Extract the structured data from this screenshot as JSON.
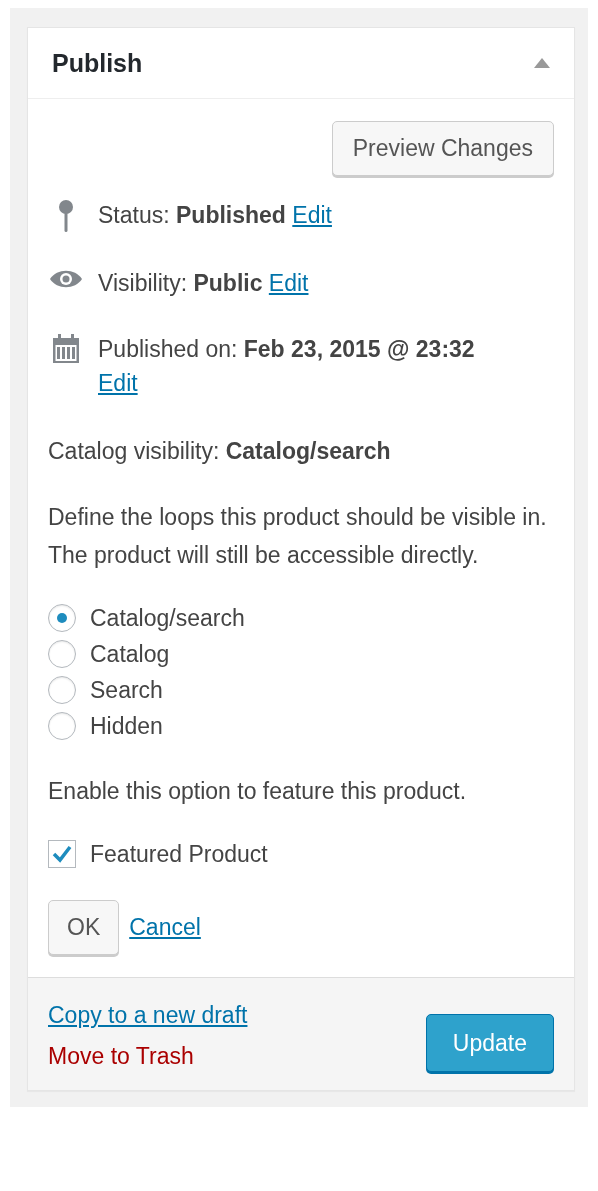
{
  "panel": {
    "title": "Publish",
    "expanded": true
  },
  "preview_button": "Preview Changes",
  "status": {
    "label": "Status:",
    "value": "Published",
    "edit": "Edit"
  },
  "visibility": {
    "label": "Visibility:",
    "value": "Public",
    "edit": "Edit"
  },
  "published": {
    "label": "Published on:",
    "value": "Feb 23, 2015 @ 23:32",
    "edit": "Edit"
  },
  "catalog_visibility": {
    "label": "Catalog visibility:",
    "value": "Catalog/search"
  },
  "description": "Define the loops this product should be visible in. The product will still be accessible directly.",
  "options": [
    {
      "label": "Catalog/search",
      "selected": true
    },
    {
      "label": "Catalog",
      "selected": false
    },
    {
      "label": "Search",
      "selected": false
    },
    {
      "label": "Hidden",
      "selected": false
    }
  ],
  "feature_hint": "Enable this option to feature this product.",
  "featured": {
    "label": "Featured Product",
    "checked": true
  },
  "buttons": {
    "ok": "OK",
    "cancel": "Cancel"
  },
  "footer": {
    "copy_link": "Copy to a new draft",
    "trash_link": "Move to Trash",
    "update_button": "Update"
  }
}
